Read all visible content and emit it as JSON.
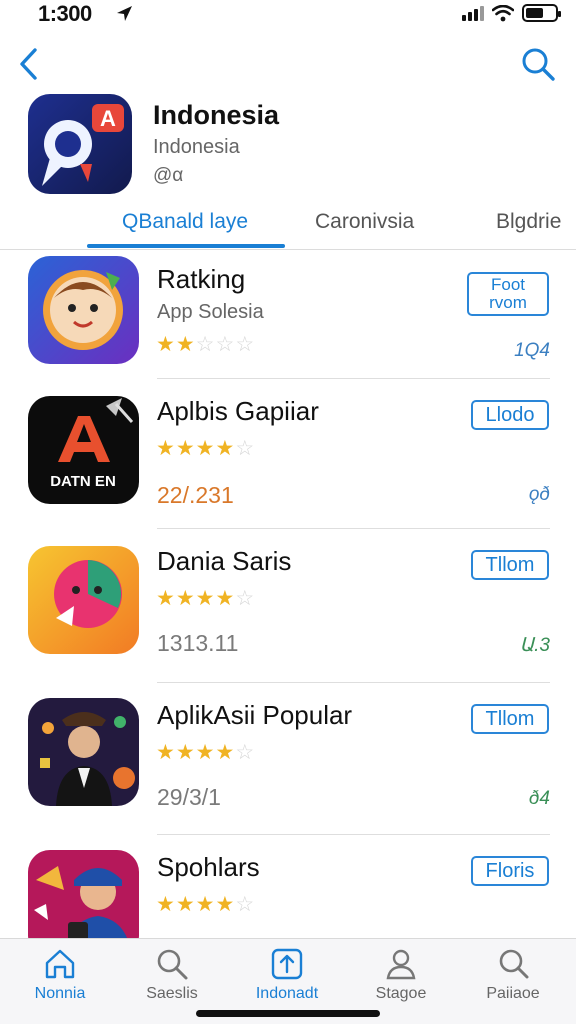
{
  "status_bar": {
    "time": "1:300"
  },
  "header": {
    "title": "Indonesia",
    "subtitle": "Indonesia",
    "meta": "@α"
  },
  "tabs": [
    {
      "label": "QBanald laye",
      "active": true
    },
    {
      "label": "Caronivsia",
      "active": false
    },
    {
      "label": "Blgdrie",
      "active": false
    }
  ],
  "apps": [
    {
      "name": "Ratking",
      "subtitle": "App Solesia",
      "rating": 2,
      "count": "",
      "button": "Foot\nrvom",
      "meta": "1Q4"
    },
    {
      "name": "Aplbis Gapiiar",
      "subtitle": "",
      "rating": 4,
      "count": "22/.231",
      "button": "Llodo",
      "meta": "ǫð"
    },
    {
      "name": "Dania Saris",
      "subtitle": "",
      "rating": 4,
      "count": "1313.11",
      "button": "Tllom",
      "meta": "Ա.3"
    },
    {
      "name": "AplikAsii Popular",
      "subtitle": "",
      "rating": 4,
      "count": "29/3/1",
      "button": "Tllom",
      "meta": "ð4"
    },
    {
      "name": "Spohlars",
      "subtitle": "",
      "rating": 4,
      "count": "",
      "button": "Floris",
      "meta": ""
    }
  ],
  "app_header_icon_letter": "A",
  "tab_bar": [
    {
      "label": "Nonnia",
      "icon": "home-icon",
      "active": true
    },
    {
      "label": "Saeslis",
      "icon": "search-icon",
      "active": false
    },
    {
      "label": "Indonadt",
      "icon": "upload-icon",
      "active": true
    },
    {
      "label": "Stagoe",
      "icon": "person-icon",
      "active": false
    },
    {
      "label": "Paiiaoe",
      "icon": "magnifier-icon",
      "active": false
    }
  ],
  "colors": {
    "accent": "#1a7fd4",
    "star": "#f0b323",
    "orange_count": "#d9782a"
  }
}
